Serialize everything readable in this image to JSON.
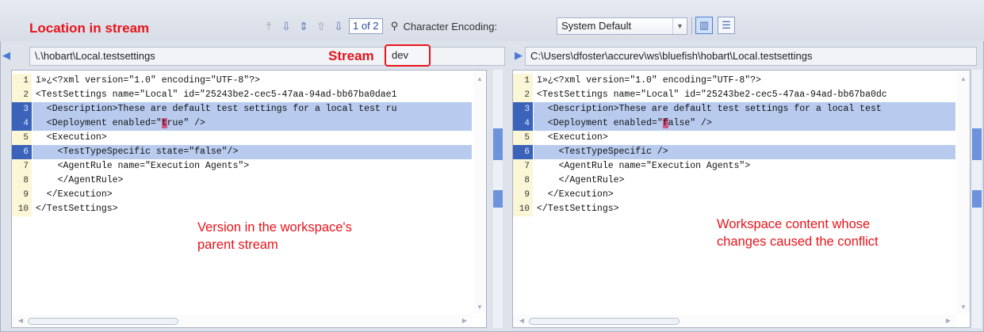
{
  "toolbar": {
    "page_indicator": "1 of 2",
    "encoding_label": "Character Encoding:",
    "encoding_value": "System Default",
    "icons": [
      "go-first-icon",
      "download-icon",
      "expand-icon",
      "up-arrow-icon",
      "down-arrow-icon"
    ]
  },
  "annotations": {
    "location": "Location in stream",
    "stream": "Stream",
    "parent_line1": "Version in the workspace's",
    "parent_line2": "parent stream",
    "ws_line1": "Workspace  content whose",
    "ws_line2": "changes caused the conflict"
  },
  "left_pane": {
    "path": "\\.\\hobart\\Local.testsettings",
    "stream_value": "dev",
    "lines": [
      {
        "num": "1",
        "changed": false,
        "text": "ï»¿<?xml version=\"1.0\" encoding=\"UTF-8\"?>"
      },
      {
        "num": "2",
        "changed": false,
        "text": "<TestSettings name=\"Local\" id=\"25243be2-cec5-47aa-94ad-bb67ba0dae1"
      },
      {
        "num": "3",
        "changed": true,
        "text": "  <Description>These are default test settings for a local test ru"
      },
      {
        "num": "4",
        "changed": true,
        "pre": "  <Deployment enabled=\"",
        "mark": "t",
        "post": "rue\" />"
      },
      {
        "num": "5",
        "changed": false,
        "text": "  <Execution>"
      },
      {
        "num": "6",
        "changed": true,
        "text": "    <TestTypeSpecific state=\"false\"/>"
      },
      {
        "num": "7",
        "changed": false,
        "text": "    <AgentRule name=\"Execution Agents\">"
      },
      {
        "num": "8",
        "changed": false,
        "text": "    </AgentRule>"
      },
      {
        "num": "9",
        "changed": false,
        "text": "  </Execution>"
      },
      {
        "num": "10",
        "changed": false,
        "text": "</TestSettings>"
      }
    ]
  },
  "right_pane": {
    "path": "C:\\Users\\dfoster\\accurev\\ws\\bluefish\\hobart\\Local.testsettings",
    "lines": [
      {
        "num": "1",
        "changed": false,
        "text": "ï»¿<?xml version=\"1.0\" encoding=\"UTF-8\"?>"
      },
      {
        "num": "2",
        "changed": false,
        "text": "<TestSettings name=\"Local\" id=\"25243be2-cec5-47aa-94ad-bb67ba0dc"
      },
      {
        "num": "3",
        "changed": true,
        "text": "  <Description>These are default test settings for a local test"
      },
      {
        "num": "4",
        "changed": true,
        "pre": "  <Deployment enabled=\"",
        "mark": "f",
        "post": "alse\" />"
      },
      {
        "num": "5",
        "changed": false,
        "text": "  <Execution>"
      },
      {
        "num": "6",
        "changed": true,
        "text": "    <TestTypeSpecific />"
      },
      {
        "num": "7",
        "changed": false,
        "text": "    <AgentRule name=\"Execution Agents\">"
      },
      {
        "num": "8",
        "changed": false,
        "text": "    </AgentRule>"
      },
      {
        "num": "9",
        "changed": false,
        "text": "  </Execution>"
      },
      {
        "num": "10",
        "changed": false,
        "text": "</TestSettings>"
      }
    ]
  },
  "colors": {
    "annotation": "#e8141b",
    "changed_line": "#b8cbef",
    "changed_gutter": "#3b63b9",
    "char_mark": "#d05a86"
  }
}
